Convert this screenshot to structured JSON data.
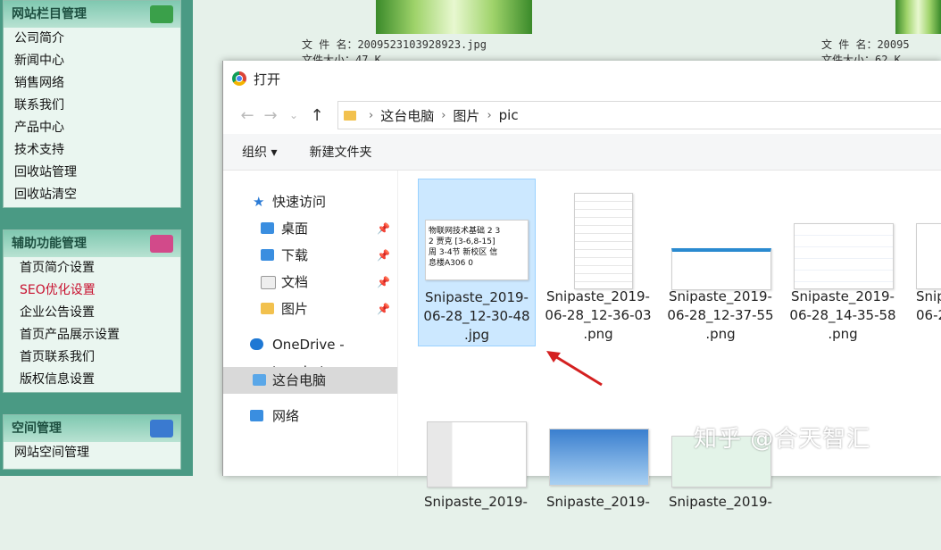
{
  "sidebar": {
    "panels": [
      {
        "title": "网站栏目管理",
        "items": [
          "公司简介",
          "新闻中心",
          "销售网络",
          "联系我们",
          "产品中心",
          "技术支持",
          "回收站管理",
          "回收站清空"
        ]
      },
      {
        "title": "辅助功能管理",
        "items": [
          "首页简介设置",
          "SEO优化设置",
          "企业公告设置",
          "首页产品展示设置",
          "首页联系我们",
          "版权信息设置"
        ]
      },
      {
        "title": "空间管理",
        "items": [
          "网站空间管理"
        ]
      }
    ]
  },
  "background": {
    "file1_name": "文 件 名：2009523103928923.jpg",
    "file1_size": "文件大小：47 K",
    "file2_name": "文 件 名：20095",
    "file2_size": "文件大小：62 K"
  },
  "dialog": {
    "title": "打开",
    "breadcrumb": [
      "这台电脑",
      "图片",
      "pic"
    ],
    "toolbar": {
      "organize": "组织 ▾",
      "new_folder": "新建文件夹"
    },
    "nav": {
      "quick_access": "快速访问",
      "desktop": "桌面",
      "downloads": "下载",
      "documents": "文档",
      "pictures": "图片",
      "onedrive": "OneDrive - tp.edu.t",
      "this_pc": "这台电脑",
      "network": "网络"
    },
    "files": [
      {
        "name": "Snipaste_2019-\n06-28_12-30-48\n.jpg",
        "preview": "物联网技术基础 2 3\n2 贾克 [3-6,8-15]\n周 3-4节 新校区 信\n息楼A306 0"
      },
      {
        "name": "Snipaste_2019-\n06-28_12-36-03\n.png"
      },
      {
        "name": "Snipaste_2019-\n06-28_12-37-55\n.png"
      },
      {
        "name": "Snipaste_2019-\n06-28_14-35-58\n.png"
      },
      {
        "name": "Snip\n06-2"
      },
      {
        "name": "Snipaste_2019-"
      },
      {
        "name": "Snipaste_2019-"
      },
      {
        "name": "Snipaste_2019-"
      }
    ]
  },
  "watermark": "知乎 @合天智汇",
  "colors": {
    "sidebar": "#4a9a84",
    "selection": "#cce8ff",
    "arrow": "#d42020"
  }
}
